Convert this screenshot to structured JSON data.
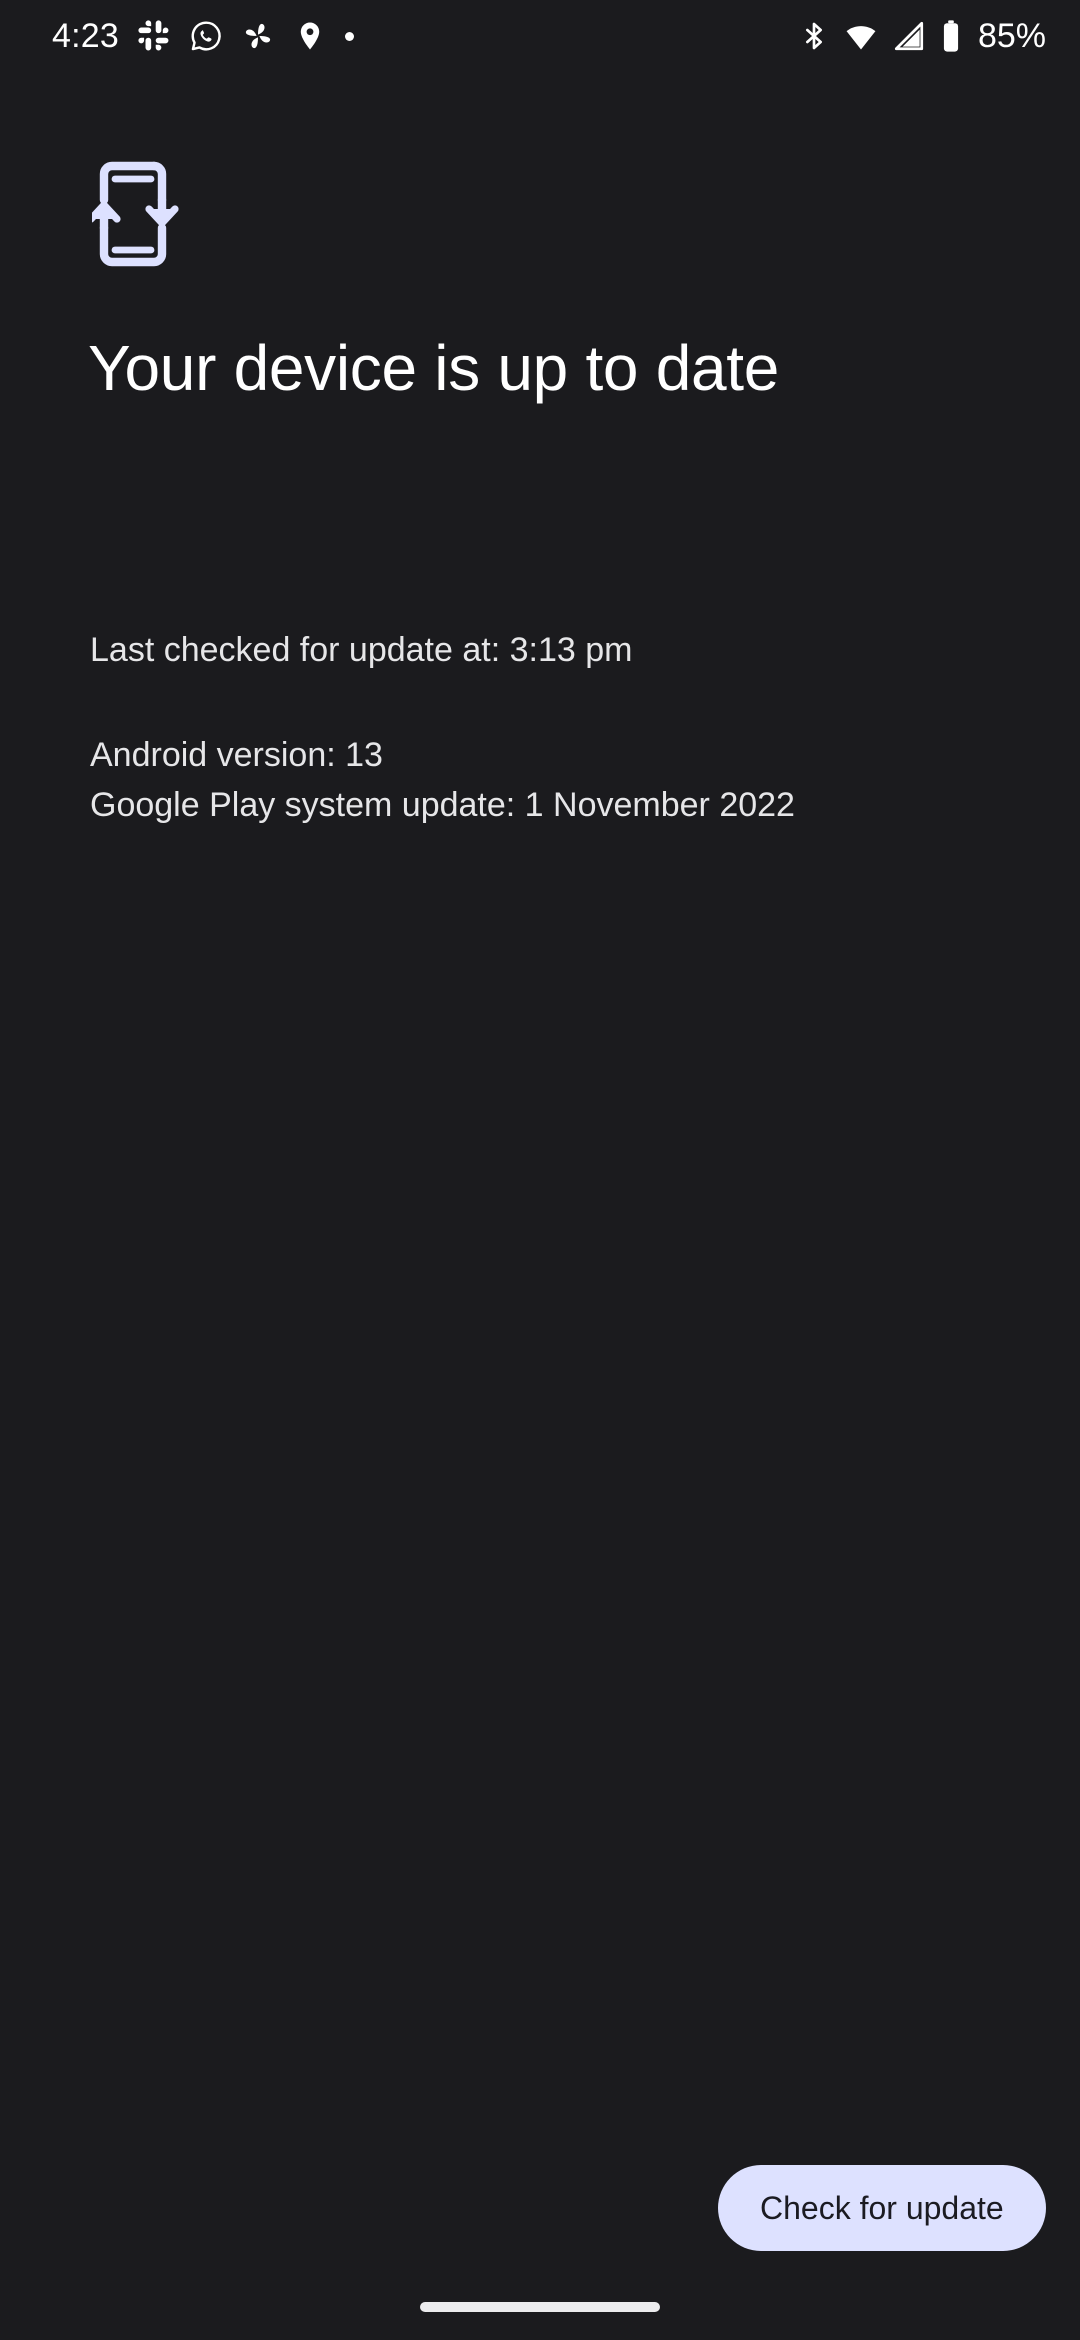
{
  "theme": {
    "background": "#1b1b1e",
    "accent": "#dde1ff",
    "text_primary": "#ffffff",
    "text_secondary": "#e6e6e8",
    "button_text": "#1b1b22"
  },
  "status_bar": {
    "time": "4:23",
    "battery_percent": "85%",
    "left_icons": [
      {
        "name": "slack-icon"
      },
      {
        "name": "whatsapp-icon"
      },
      {
        "name": "pinwheel-icon"
      },
      {
        "name": "location-pin-icon"
      },
      {
        "name": "notification-dot-icon"
      }
    ],
    "right_icons": [
      {
        "name": "bluetooth-icon"
      },
      {
        "name": "wifi-icon"
      },
      {
        "name": "cellular-signal-icon"
      },
      {
        "name": "battery-icon"
      }
    ]
  },
  "main": {
    "header_icon": "system-update-icon",
    "title": "Your device is up to date",
    "last_checked": "Last checked for update at: 3:13 pm",
    "details": [
      "Android version: 13",
      "Google Play system update: 1 November 2022"
    ]
  },
  "actions": {
    "check_for_update_label": "Check for update"
  },
  "navigation": {
    "gesture_pill": "home-gesture-pill"
  }
}
